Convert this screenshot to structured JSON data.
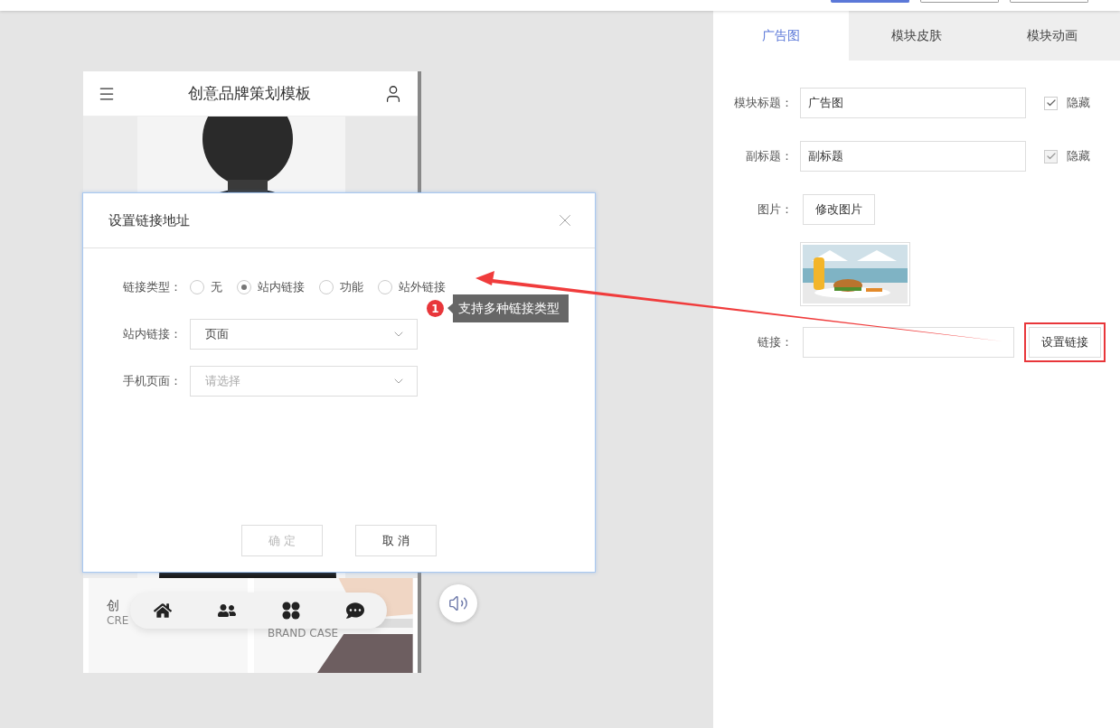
{
  "top_buttons": [
    {
      "primary": true
    },
    {
      "primary": false
    },
    {
      "primary": false
    }
  ],
  "preview": {
    "title": "创意品牌策划模板",
    "cards": [
      {
        "title": "创",
        "subtitle": "CRE"
      },
      {
        "subtitle": "BRAND CASE"
      }
    ]
  },
  "dialog": {
    "title": "设置链接地址",
    "link_type": {
      "label": "链接类型：",
      "options": [
        {
          "label": "无",
          "selected": false
        },
        {
          "label": "站内链接",
          "selected": true
        },
        {
          "label": "功能",
          "selected": false
        },
        {
          "label": "站外链接",
          "selected": false
        }
      ]
    },
    "selects": [
      {
        "label": "站内链接：",
        "value": "页面"
      },
      {
        "label": "手机页面：",
        "placeholder": "请选择"
      }
    ],
    "buttons": [
      {
        "label": "确 定",
        "disabled": true
      },
      {
        "label": "取 消",
        "disabled": false
      }
    ]
  },
  "annotation": {
    "number": "1",
    "text": "支持多种链接类型"
  },
  "panel": {
    "tabs": [
      {
        "label": "广告图",
        "selected": true
      },
      {
        "label": "模块皮肤",
        "selected": false
      },
      {
        "label": "模块动画",
        "selected": false
      }
    ],
    "fields": [
      {
        "kind": "text",
        "label": "模块标题：",
        "value": "广告图",
        "checkbox": {
          "label": "隐藏",
          "checked": true,
          "disabled": false
        }
      },
      {
        "kind": "text",
        "label": "副标题：",
        "value": "副标题",
        "checkbox": {
          "label": "隐藏",
          "checked": true,
          "disabled": true
        }
      },
      {
        "label": "图片：",
        "button": "修改图片"
      },
      {
        "kind": "link",
        "label": "链接：",
        "button": "设置链接",
        "highlighted": true
      }
    ]
  }
}
